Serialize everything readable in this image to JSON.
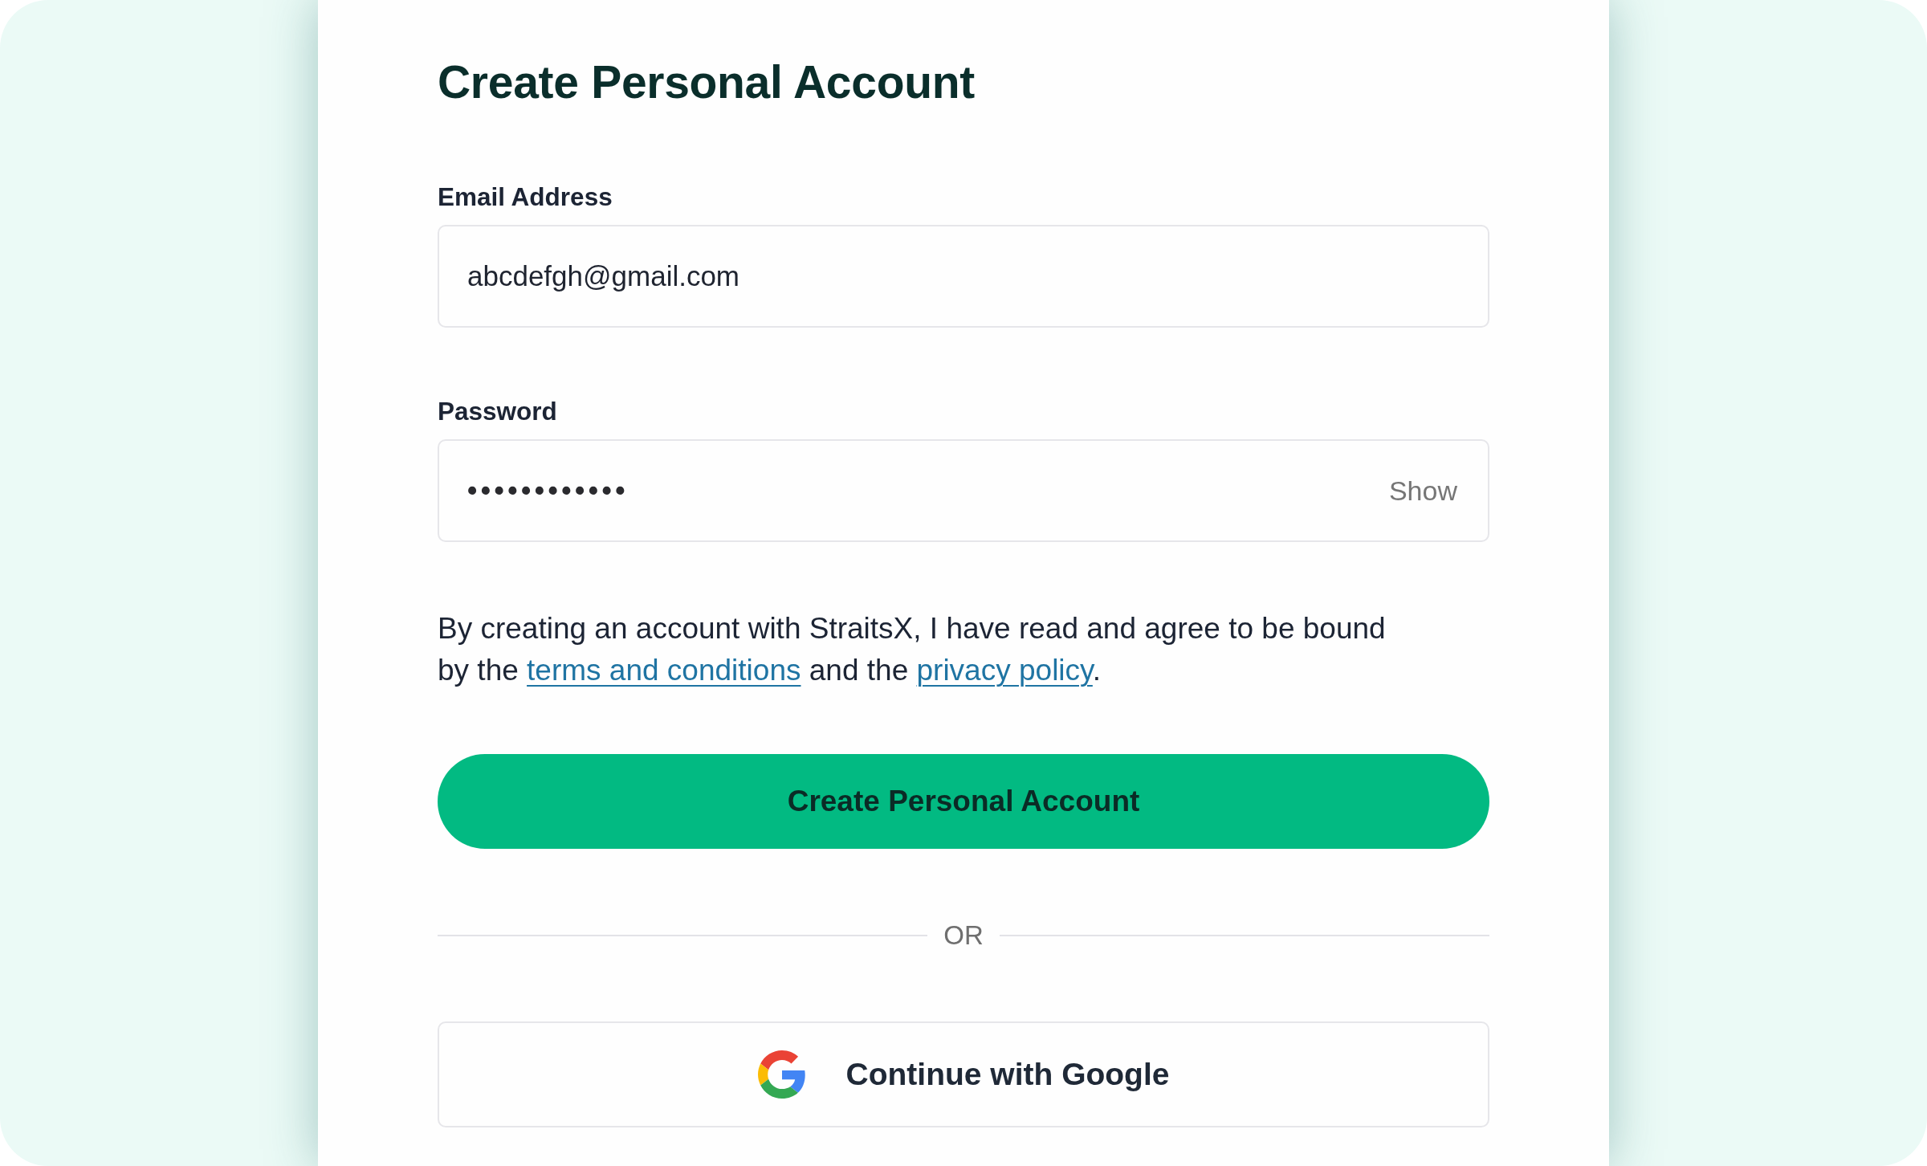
{
  "title": "Create Personal Account",
  "fields": [
    {
      "kind": "text",
      "label": "Email Address",
      "value": "abcdefgh@gmail.com"
    },
    {
      "kind": "password",
      "label": "Password",
      "value": "••••••••••••",
      "action": "Show"
    }
  ],
  "terms": {
    "parts": [
      {
        "kind": "text",
        "text": "By creating an account with StraitsX, I have read and agree to be bound by the "
      },
      {
        "kind": "link",
        "text": "terms and conditions"
      },
      {
        "kind": "text",
        "text": " and the "
      },
      {
        "kind": "link",
        "text": "privacy policy"
      },
      {
        "kind": "text",
        "text": "."
      }
    ]
  },
  "primary_button": {
    "label": "Create Personal Account"
  },
  "divider": {
    "label": "OR"
  },
  "google_button": {
    "label": "Continue with Google"
  }
}
